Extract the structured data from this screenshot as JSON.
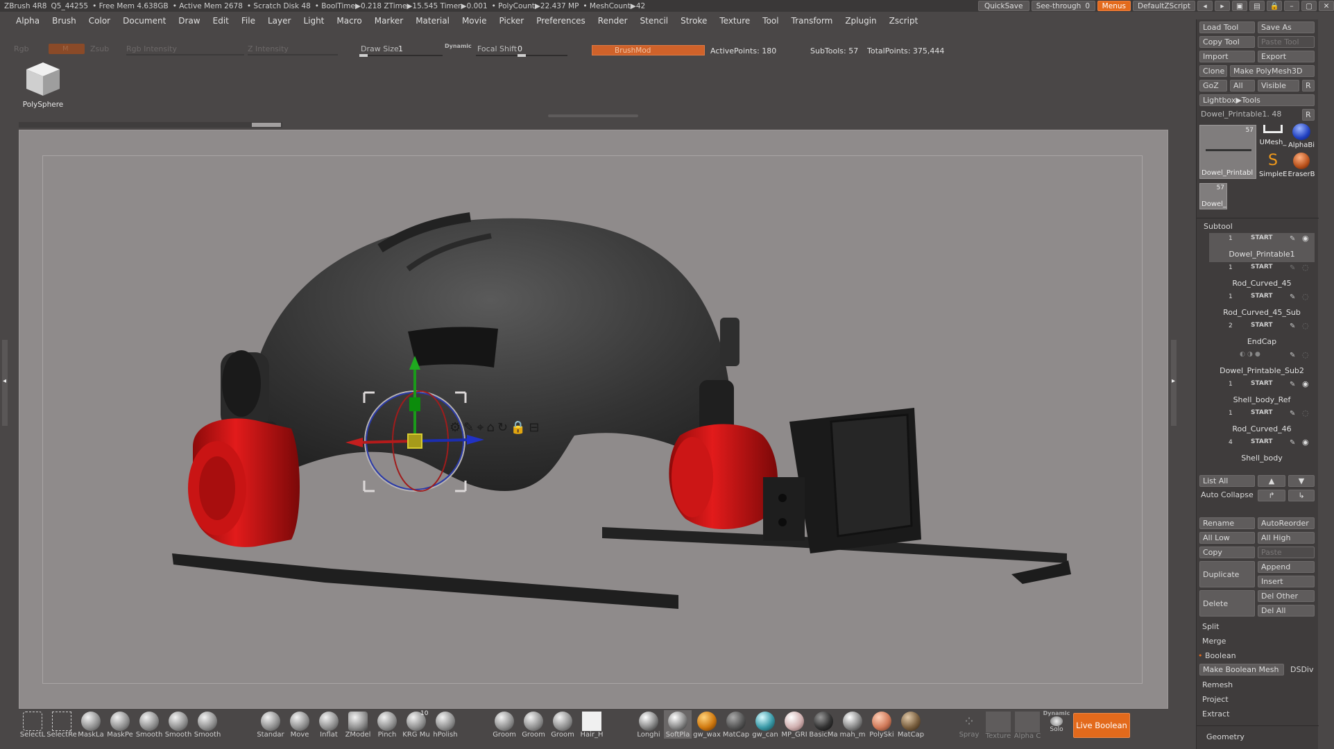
{
  "titlebar": {
    "app": "ZBrush 4R8",
    "project": "Q5_44255",
    "free_mem": "• Free Mem 4.638GB",
    "active_mem": "• Active Mem 2678",
    "scratch": "• Scratch Disk 48",
    "booltime": "• BoolTime▶0.218 ZTime▶15.545 Timer▶0.001",
    "polycount": "• PolyCount▶22.437 MP",
    "meshcount": "• MeshCount▶42",
    "quicksave": "QuickSave",
    "seethrough": "See-through",
    "seethrough_value": "0",
    "menus": "Menus",
    "script": "DefaultZScript"
  },
  "menubar": [
    "Alpha",
    "Brush",
    "Color",
    "Document",
    "Draw",
    "Edit",
    "File",
    "Layer",
    "Light",
    "Macro",
    "Marker",
    "Material",
    "Movie",
    "Picker",
    "Preferences",
    "Render",
    "Stencil",
    "Stroke",
    "Texture",
    "Tool",
    "Transform",
    "Zplugin",
    "Zscript"
  ],
  "topshelf": {
    "rgb": "Rgb",
    "mrgb": "M",
    "zsub": "Zsub",
    "rgb_intensity": "Rgb Intensity",
    "z_intensity": "Z Intensity",
    "draw_size_label": "Draw Size",
    "draw_size_value": "1",
    "dynamic": "Dynamic",
    "focal_shift_label": "Focal Shift",
    "focal_shift_value": "0",
    "brushmod": "BrushMod",
    "active_points": "ActivePoints: 180",
    "subtools": "SubTools: 57",
    "total_points": "TotalPoints: 375,444",
    "polysphere": "PolySphere"
  },
  "gizmo_icons": [
    "gear-icon",
    "pin-icon",
    "location-icon",
    "home-icon",
    "rotate-icon",
    "lock-icon",
    "minus-icon"
  ],
  "rightpanel": {
    "load_tool": "Load Tool",
    "save_as": "Save As",
    "copy_tool": "Copy Tool",
    "paste_tool": "Paste Tool",
    "import": "Import",
    "export": "Export",
    "clone": "Clone",
    "make_polymesh": "Make PolyMesh3D",
    "goz": "GoZ",
    "all": "All",
    "visible": "Visible",
    "r": "R",
    "lightbox_tools": "Lightbox▶Tools",
    "current_tool": "Dowel_Printable1. 48",
    "thumb_count": "57",
    "thumb_label": "Dowel_Printabl",
    "small_thumb_count": "57",
    "small_thumb_label": "Dowel_",
    "tool_umesh": "UMesh_",
    "tool_alphab": "AlphaBi",
    "tool_simple": "SimpleE",
    "tool_eraser": "EraserB",
    "subtool_header": "Subtool",
    "start": "START",
    "subtools": [
      {
        "name": "Dowel_Printable1",
        "num": "1"
      },
      {
        "name": "Rod_Curved_45",
        "num": "1"
      },
      {
        "name": "Rod_Curved_45_Sub",
        "num": "1"
      },
      {
        "name": "EndCap",
        "num": "2"
      },
      {
        "name": "Dowel_Printable_Sub2",
        "num": ""
      },
      {
        "name": "Shell_body_Ref",
        "num": "1"
      },
      {
        "name": "Rod_Curved_46",
        "num": "1"
      },
      {
        "name": "Shell_body",
        "num": "4"
      }
    ],
    "list_all": "List All",
    "auto_collapse": "Auto Collapse",
    "rename": "Rename",
    "autoreorder": "AutoReorder",
    "all_low": "All Low",
    "all_high": "All High",
    "copy": "Copy",
    "paste": "Paste",
    "append": "Append",
    "duplicate": "Duplicate",
    "insert": "Insert",
    "del_other": "Del Other",
    "delete": "Delete",
    "del_all": "Del All",
    "split": "Split",
    "merge": "Merge",
    "boolean": "Boolean",
    "make_boolean_mesh": "Make Boolean Mesh",
    "dsdiv": "DSDiv",
    "remesh": "Remesh",
    "project": "Project",
    "extract": "Extract",
    "geometry": "Geometry"
  },
  "bottomshelf": {
    "tools": [
      "SelectL",
      "SelectRe",
      "MaskLa",
      "MaskPe",
      "Smooth",
      "Smooth",
      "Smooth",
      "Standar",
      "Move",
      "Inflat",
      "ZModel",
      "Pinch",
      "KRG Mu",
      "hPolish",
      "Groom",
      "Groom",
      "Groom",
      "Hair_H"
    ],
    "krg_count": "10",
    "materials": [
      "Longhi",
      "SoftPla",
      "gw_wax",
      "MatCap",
      "gw_can",
      "MP_GRI",
      "BasicMa",
      "mah_m",
      "PolySki",
      "MatCap"
    ],
    "spray": "Spray",
    "texture": "Texture",
    "alpha": "Alpha C",
    "dynamic": "Dynamic",
    "solo": "Solo",
    "live_boolean": "Live Boolean"
  },
  "colors": {
    "accent_orange": "#e36a1c",
    "helmet": "#3d3d3d",
    "caps_red": "#d81515",
    "viewport_bg": "#8f8b8b"
  }
}
